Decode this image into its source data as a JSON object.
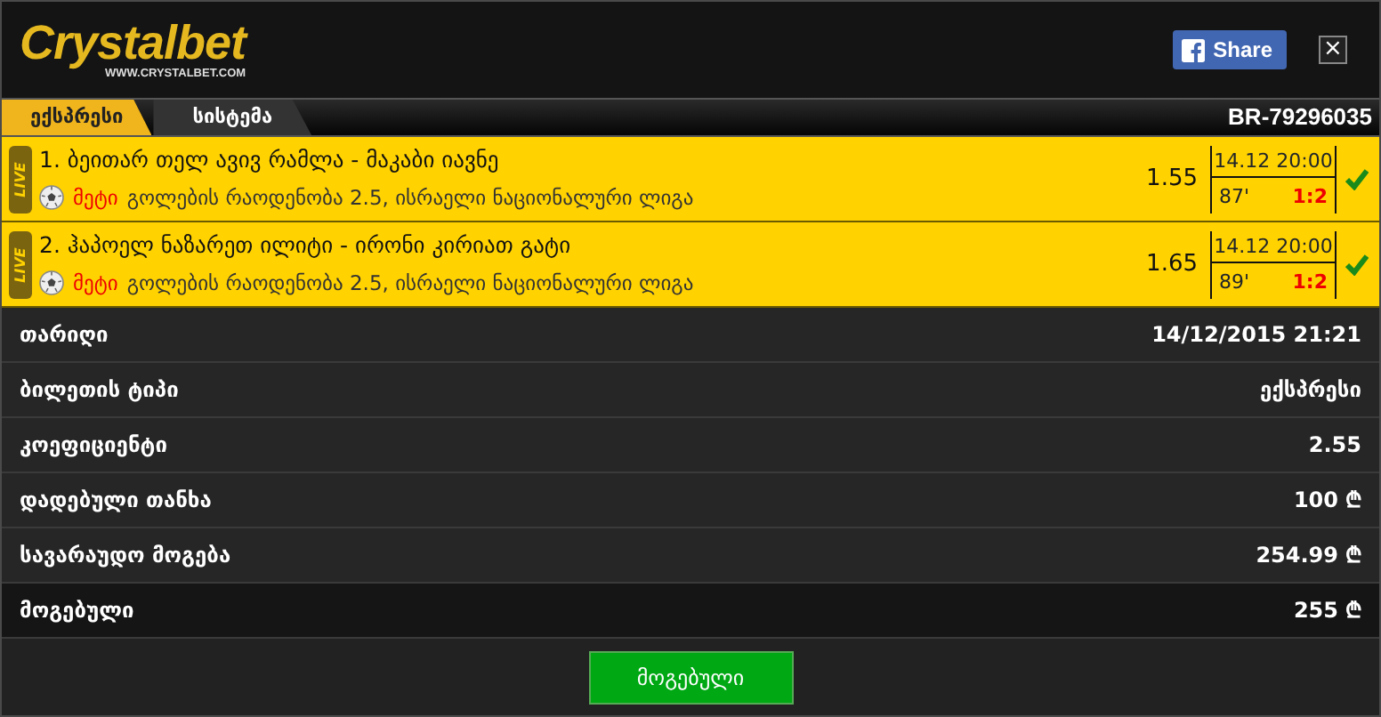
{
  "logo": {
    "name": "Crystalbet",
    "site": "WWW.CRYSTALBET.COM"
  },
  "share_button": "Share",
  "close_button": "×",
  "tabs": [
    {
      "label": "ექსპრესი",
      "selected": true
    },
    {
      "label": "სისტემა",
      "selected": false
    }
  ],
  "ticket_id": "BR-79296035",
  "bets": [
    {
      "badge": "LIVE",
      "title": "1. ბეითარ თელ ავივ რამლა - მაკაბი იავნე",
      "pick": "მეტი",
      "market": "გოლების რაოდენობა 2.5, ისრაელი ნაციონალური ლიგა",
      "odds": "1.55",
      "datetime": "14.12 20:00",
      "minute": "87'",
      "score": "1:2",
      "won": true
    },
    {
      "badge": "LIVE",
      "title": "2. ჰაპოელ ნაზარეთ ილიტი - ირონი კირიათ გატი",
      "pick": "მეტი",
      "market": "გოლების რაოდენობა 2.5, ისრაელი ნაციონალური ლიგა",
      "odds": "1.65",
      "datetime": "14.12 20:00",
      "minute": "89'",
      "score": "1:2",
      "won": true
    }
  ],
  "details": [
    {
      "label": "თარიღი",
      "value": "14/12/2015 21:21",
      "highlight": false
    },
    {
      "label": "ბილეთის ტიპი",
      "value": "ექსპრესი",
      "highlight": false
    },
    {
      "label": "კოეფიციენტი",
      "value": "2.55",
      "highlight": false
    },
    {
      "label": "დადებული თანხა",
      "value": "100",
      "currency": "₾",
      "highlight": false
    },
    {
      "label": "სავარაუდო მოგება",
      "value": "254.99",
      "currency": "₾",
      "highlight": false
    },
    {
      "label": "მოგებული",
      "value": "255",
      "currency": "₾",
      "highlight": true
    }
  ],
  "status_button": "მოგებული"
}
